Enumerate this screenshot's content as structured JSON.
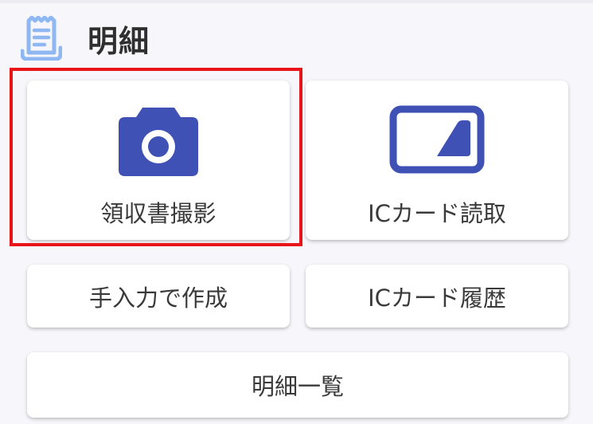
{
  "header": {
    "title": "明細",
    "icon": "receipt-icon"
  },
  "actions": {
    "camera": {
      "label": "領収書撮影",
      "icon": "camera-icon"
    },
    "ic_read": {
      "label": "ICカード読取",
      "icon": "ic-card-icon"
    },
    "manual": {
      "label": "手入力で作成"
    },
    "ic_history": {
      "label": "ICカード履歴"
    },
    "list": {
      "label": "明細一覧"
    }
  },
  "colors": {
    "accent": "#3f51b5",
    "header_icon": "#8fb8f2",
    "highlight": "#e8141a",
    "background": "#f6f6fb"
  }
}
